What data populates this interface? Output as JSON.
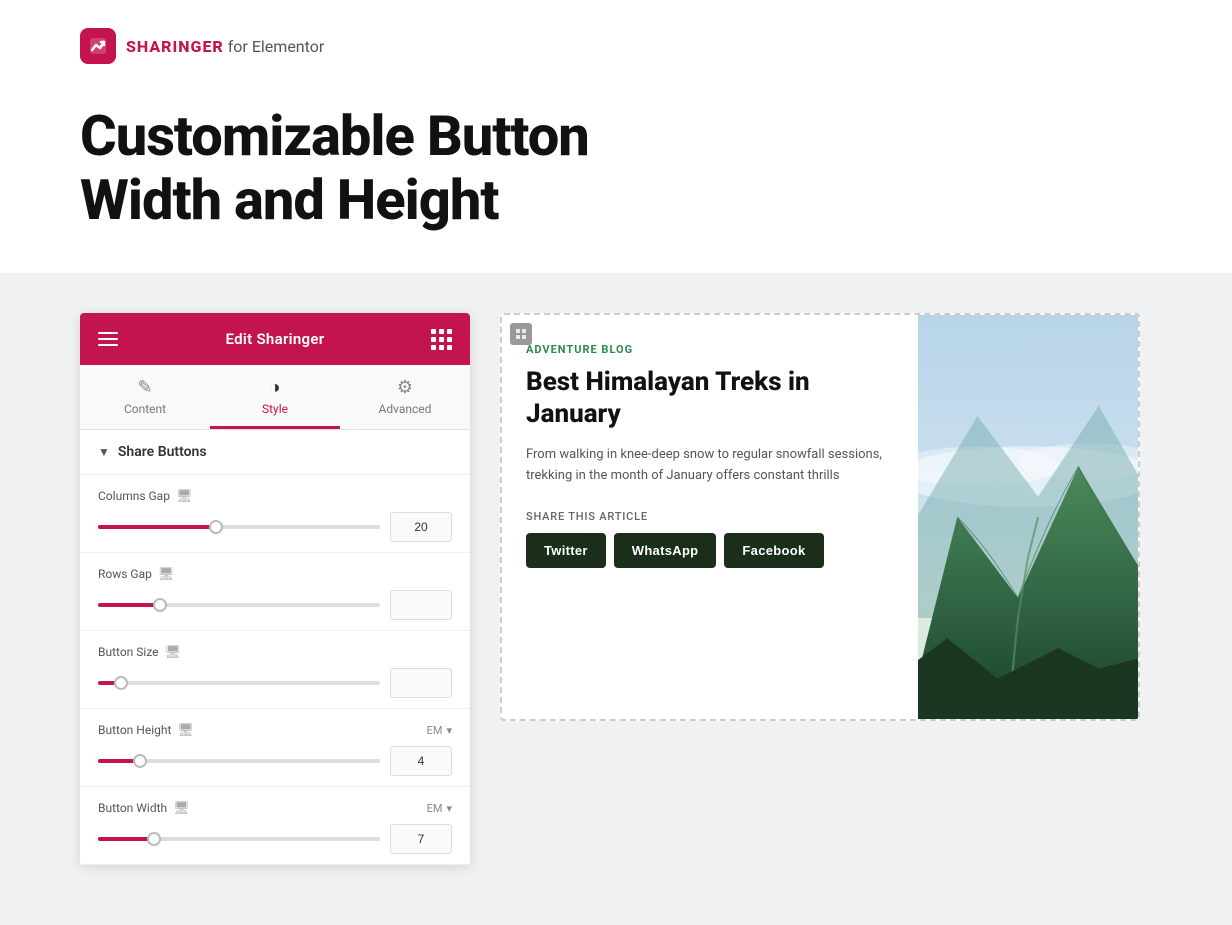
{
  "header": {
    "logo_bold": "SHARINGER",
    "logo_thin": " for Elementor"
  },
  "hero": {
    "title_line1": "Customizable Button",
    "title_line2": "Width and Height"
  },
  "panel": {
    "title": "Edit Sharinger",
    "tabs": [
      {
        "id": "content",
        "label": "Content",
        "icon": "✏️"
      },
      {
        "id": "style",
        "label": "Style",
        "icon": "◑",
        "active": true
      },
      {
        "id": "advanced",
        "label": "Advanced",
        "icon": "⚙️"
      }
    ],
    "section": {
      "title": "Share Buttons"
    },
    "controls": [
      {
        "id": "columns-gap",
        "label": "Columns Gap",
        "has_screen_icon": true,
        "slider_percent": 42,
        "value": "20"
      },
      {
        "id": "rows-gap",
        "label": "Rows Gap",
        "has_screen_icon": true,
        "slider_percent": 25,
        "value": ""
      },
      {
        "id": "button-size",
        "label": "Button Size",
        "has_screen_icon": true,
        "slider_percent": 8,
        "value": ""
      },
      {
        "id": "button-height",
        "label": "Button Height",
        "has_screen_icon": true,
        "unit": "EM",
        "slider_percent": 15,
        "value": "4"
      },
      {
        "id": "button-width",
        "label": "Button Width",
        "has_screen_icon": true,
        "unit": "EM",
        "slider_percent": 20,
        "value": "7"
      }
    ]
  },
  "article": {
    "category": "ADVENTURE BLOG",
    "title": "Best Himalayan Treks in January",
    "excerpt": "From walking in knee-deep snow to regular snowfall sessions, trekking in the month of January offers constant thrills",
    "share_label": "SHARE THIS ARTICLE",
    "share_buttons": [
      {
        "id": "twitter",
        "label": "Twitter"
      },
      {
        "id": "whatsapp",
        "label": "WhatsApp"
      },
      {
        "id": "facebook",
        "label": "Facebook"
      }
    ]
  }
}
